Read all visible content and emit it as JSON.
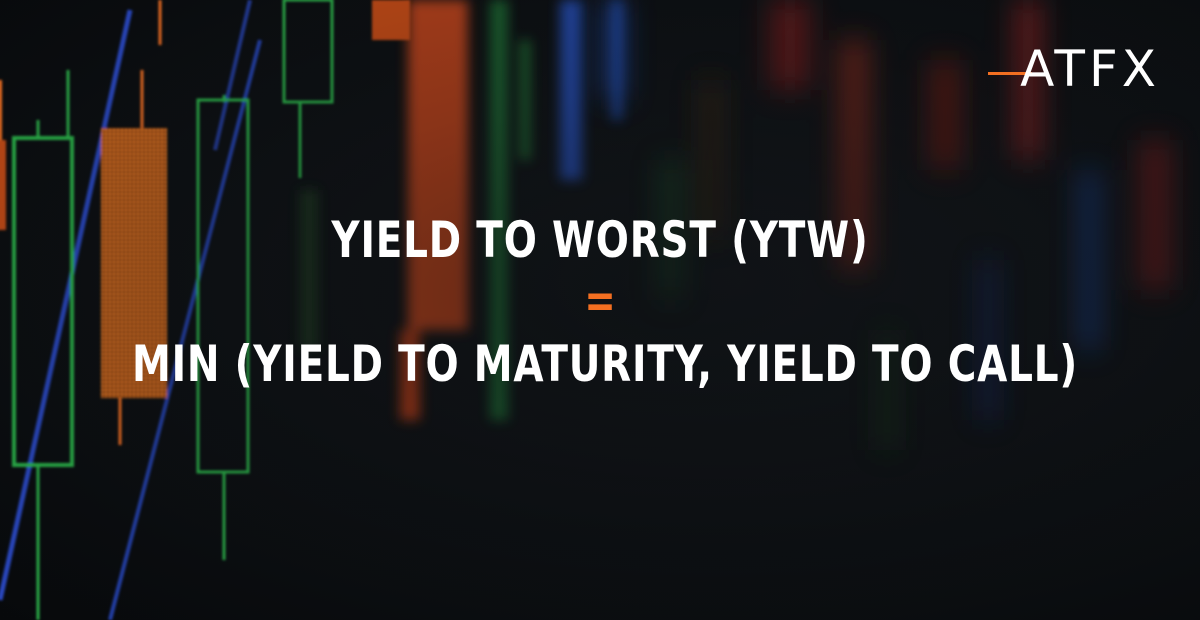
{
  "brand": {
    "logo_text": "ATFX",
    "accent_color": "#f36f21"
  },
  "headline": {
    "line1": "YIELD TO WORST (YTW)",
    "equals": "=",
    "line2": "MIN (YIELD TO MATURITY, YIELD TO CALL)"
  },
  "background": {
    "description_icon": "candlestick-chart-background",
    "colors": [
      "#2bb24a",
      "#f36f21",
      "#2d4fd6",
      "#0c0f12"
    ]
  }
}
